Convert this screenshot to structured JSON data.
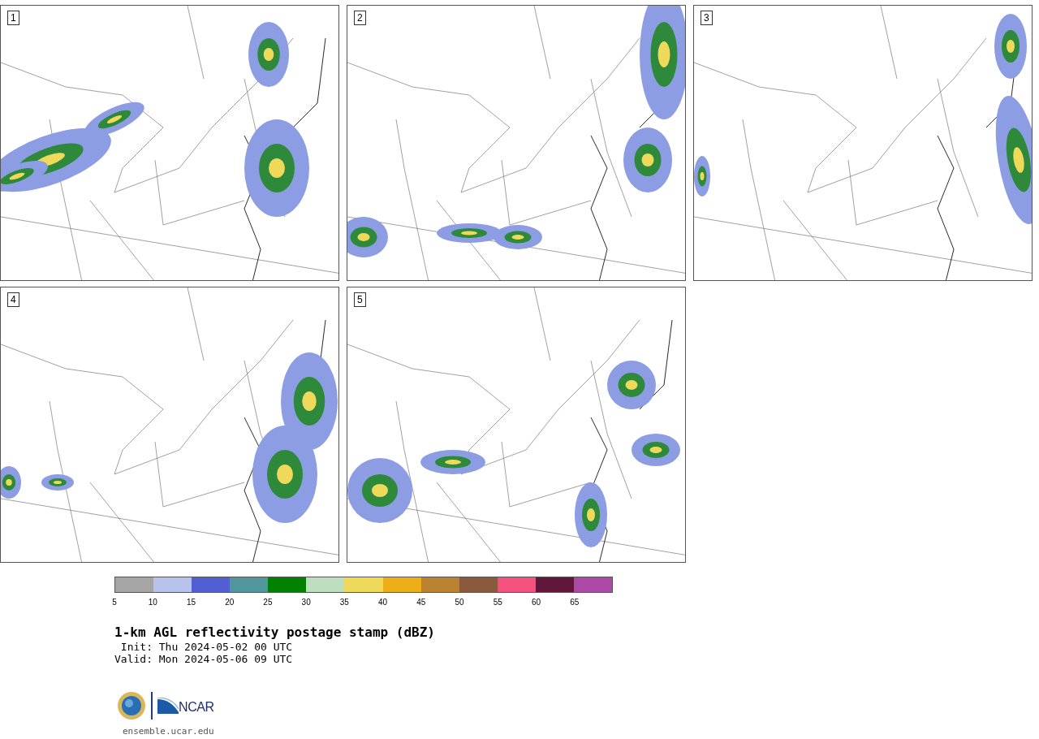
{
  "panels": [
    {
      "label": "1"
    },
    {
      "label": "2"
    },
    {
      "label": "3"
    },
    {
      "label": "4"
    },
    {
      "label": "5"
    }
  ],
  "colorbar": {
    "bins": [
      {
        "color": "#a5a5a5"
      },
      {
        "color": "#b8c3eb"
      },
      {
        "color": "#525fd3"
      },
      {
        "color": "#4f979c"
      },
      {
        "color": "#008100"
      },
      {
        "color": "#bedfbd"
      },
      {
        "color": "#eed95b"
      },
      {
        "color": "#eeae17"
      },
      {
        "color": "#bb8331"
      },
      {
        "color": "#8b5a3e"
      },
      {
        "color": "#f4527e"
      },
      {
        "color": "#62163a"
      },
      {
        "color": "#ad4aa8"
      }
    ],
    "ticks": [
      "5",
      "10",
      "15",
      "20",
      "25",
      "30",
      "35",
      "40",
      "45",
      "50",
      "55",
      "60",
      "65"
    ]
  },
  "title": "1-km AGL reflectivity postage stamp (dBZ)",
  "init": " Init: Thu 2024-05-02 00 UTC",
  "valid": "Valid: Mon 2024-05-06 09 UTC",
  "logo": {
    "text": "NCAR"
  },
  "footer": "ensemble.ucar.edu"
}
